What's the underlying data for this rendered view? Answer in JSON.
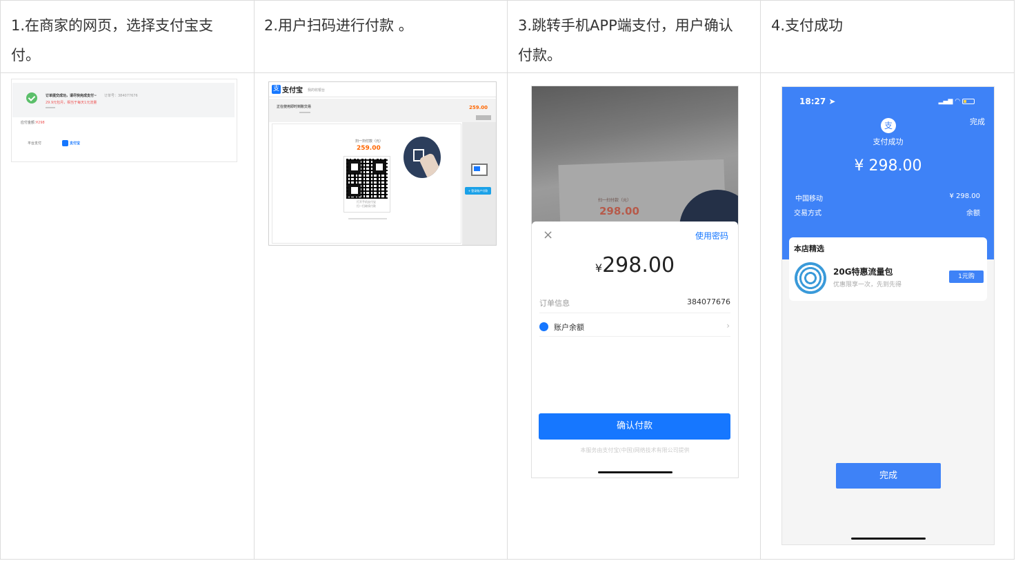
{
  "steps": [
    {
      "title_line1": "1.在商家的网页，选择支付宝支",
      "title_line2": "付。"
    },
    {
      "title_line1": "2.用户扫码进行付款 。",
      "title_line2": ""
    },
    {
      "title_line1": "3.跳转手机APP端支付，用户确认",
      "title_line2": "付款。"
    },
    {
      "title_line1": "4.支付成功",
      "title_line2": ""
    }
  ],
  "panel1": {
    "notice": "订单提交成功，请尽快完成支付~",
    "order_no_label": "订单号：384077676",
    "sub": "29.9元包月，相当于每天1元流量",
    "amount_label": "应付金额：",
    "amount": "¥298",
    "method_label": "平台支付",
    "alipay_label": "支付宝"
  },
  "panel2": {
    "brand": "支付宝",
    "brand_sub": "我的收银台",
    "order_line": "正在使用即时到账交易",
    "amount_right": "259.00",
    "scan_label": "扫一扫付款（元）",
    "amount": "259.00",
    "qr_hint1": "打开手机支付宝",
    "qr_hint2": "扫一扫继续付款",
    "login_btn": "+ 登录账户付款",
    "pc_label": "支付宝"
  },
  "panel3": {
    "photo_label": "扫一扫付款（元）",
    "photo_amount": "298.00",
    "close": "×",
    "use_password": "使用密码",
    "currency": "¥",
    "amount": "298.00",
    "order_info_label": "订单信息",
    "order_info_value": "384077676",
    "method": "账户余额",
    "chevron": "›",
    "confirm": "确认付款",
    "footer": "本服务由支付宝(中国)网络技术有限公司提供"
  },
  "panel4": {
    "time": "18:27",
    "done_top": "完成",
    "success": "支付成功",
    "amount": "¥ 298.00",
    "merchant": "中国移动",
    "merchant_amount": "¥ 298.00",
    "pay_method_label": "交易方式",
    "pay_method_value": "余额",
    "card_title": "本店精选",
    "product_name": "20G特惠流量包",
    "product_desc": "优惠限享一次，先到先得",
    "buy_label": "1元购",
    "done_button": "完成"
  }
}
